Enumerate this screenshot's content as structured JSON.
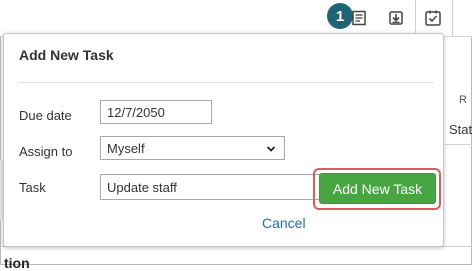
{
  "toolbar": {
    "badge": "1",
    "icons": [
      "notes-icon",
      "download-icon",
      "task-checkbox-icon"
    ]
  },
  "background": {
    "tab_partial_1": "R",
    "tab_partial_2": "Stat",
    "bottom_partial": "tion"
  },
  "popup": {
    "title": "Add New Task",
    "due_date_label": "Due date",
    "due_date_value": "12/7/2050",
    "assign_to_label": "Assign to",
    "assign_to_value": "Myself",
    "task_label": "Task",
    "task_value": "Update staff",
    "cancel_label": "Cancel",
    "add_button_label": "Add New Task"
  },
  "colors": {
    "badge_bg": "#1f6476",
    "add_button_bg": "#47a642",
    "highlight_outline": "#e0595d",
    "link": "#1f6db3"
  }
}
